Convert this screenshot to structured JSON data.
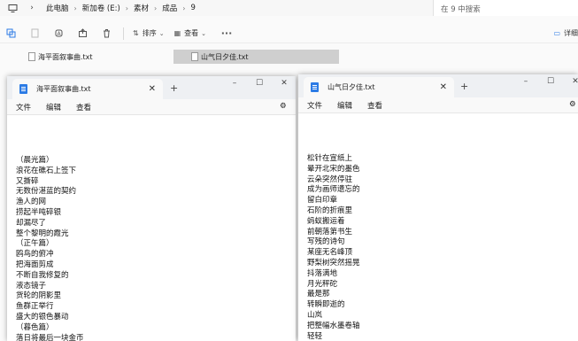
{
  "explorer": {
    "breadcrumb": [
      "此电脑",
      "新加卷 (E:)",
      "素材",
      "成品",
      "9"
    ],
    "search_placeholder": "在 9 中搜索",
    "sort_label": "排序",
    "view_label": "查看",
    "more_label": "···",
    "details_label": "详细",
    "files": [
      "海平面叙事曲.txt",
      "山气日夕佳.txt"
    ]
  },
  "notepad_left": {
    "tab_title": "海平面叙事曲.txt",
    "menu": [
      "文件",
      "编辑",
      "查看"
    ],
    "lines": [
      "（晨光篇）",
      "浪花在礁石上签下",
      "又撕碎",
      "无数份湛蓝的契约",
      "渔人的网",
      "捞起半吨碎银",
      "却漏尽了",
      "整个黎明的霞光",
      "（正午篇）",
      "鸥鸟的俯冲",
      "把海面剪成",
      "不断自我修复的",
      "液态镜子",
      "货轮的阴影里",
      "鱼群正举行",
      "盛大的银色暴动",
      "（暮色篇）",
      "落日将最后一块金币"
    ]
  },
  "notepad_right": {
    "tab_title": "山气日夕佳.txt",
    "menu": [
      "文件",
      "编辑",
      "查看"
    ],
    "lines": [
      "松针在宣纸上",
      "晕开北宋的墨色",
      "云朵突然停驻",
      "成为画师遗忘的",
      "留白印章",
      "石阶的折痕里",
      "蚂蚁搬运着",
      "前朝落第书生",
      "写残的诗句",
      "某座无名峰顶",
      "野梨树突然摇晃",
      "抖落满地",
      "月光秤砣",
      "最是那",
      "转瞬即逝的",
      "山岚",
      "把整幅水墨卷轴",
      "轻轻"
    ]
  }
}
